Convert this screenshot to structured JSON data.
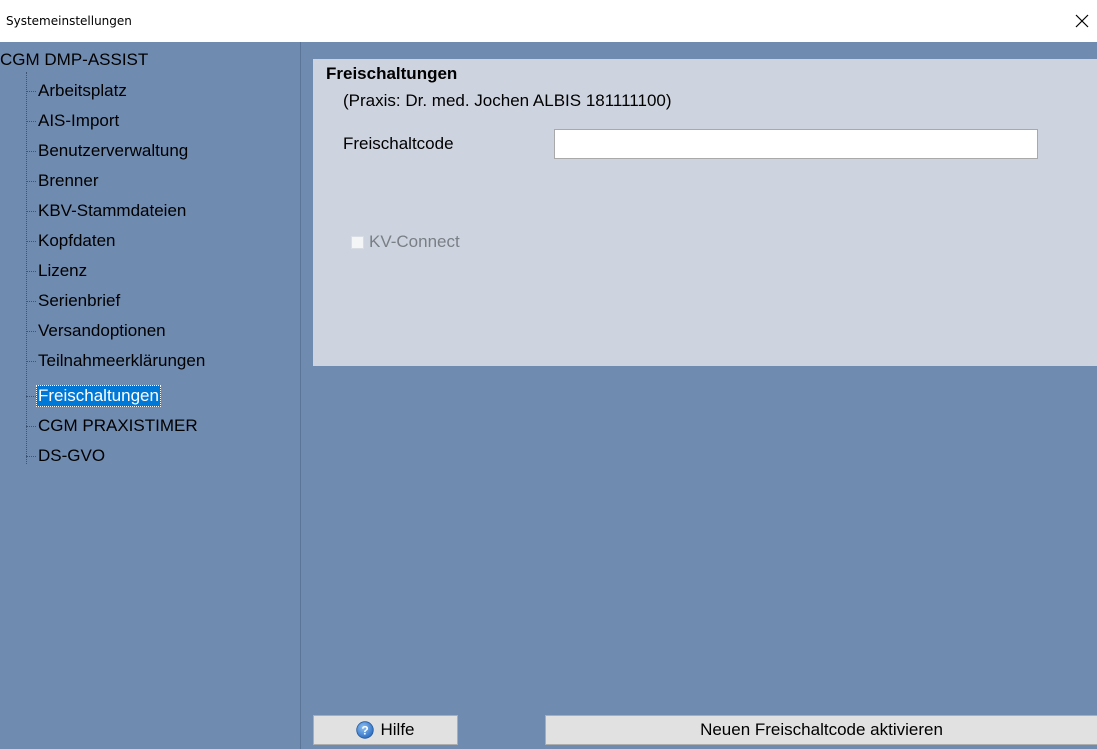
{
  "window": {
    "title": "Systemeinstellungen",
    "close_glyph": "✕"
  },
  "tree": {
    "root_label": "CGM DMP-ASSIST",
    "items": [
      {
        "label": "Arbeitsplatz"
      },
      {
        "label": "AIS-Import"
      },
      {
        "label": "Benutzerverwaltung"
      },
      {
        "label": "Brenner"
      },
      {
        "label": "KBV-Stammdateien"
      },
      {
        "label": "Kopfdaten"
      },
      {
        "label": "Lizenz"
      },
      {
        "label": "Serienbrief"
      },
      {
        "label": "Versandoptionen"
      },
      {
        "label": "Teilnahmeerklärungen"
      },
      {
        "label": "Freischaltungen",
        "selected": true
      },
      {
        "label": "CGM PRAXISTIMER"
      },
      {
        "label": "DS-GVO"
      }
    ]
  },
  "content": {
    "group_title": "Freischaltungen",
    "praxis_line": "(Praxis: Dr. med. Jochen ALBIS 181111100)",
    "code_label": "Freischaltcode",
    "code_value": "",
    "kv_connect_label": "KV-Connect",
    "kv_connect_checked": false,
    "kv_connect_enabled": false
  },
  "buttons": {
    "help_label": "Hilfe",
    "help_icon": "help-icon",
    "activate_label": "Neuen Freischaltcode aktivieren"
  },
  "colors": {
    "background": "#6f8bb0",
    "panel": "#ced4df",
    "selection": "#0078d7"
  }
}
